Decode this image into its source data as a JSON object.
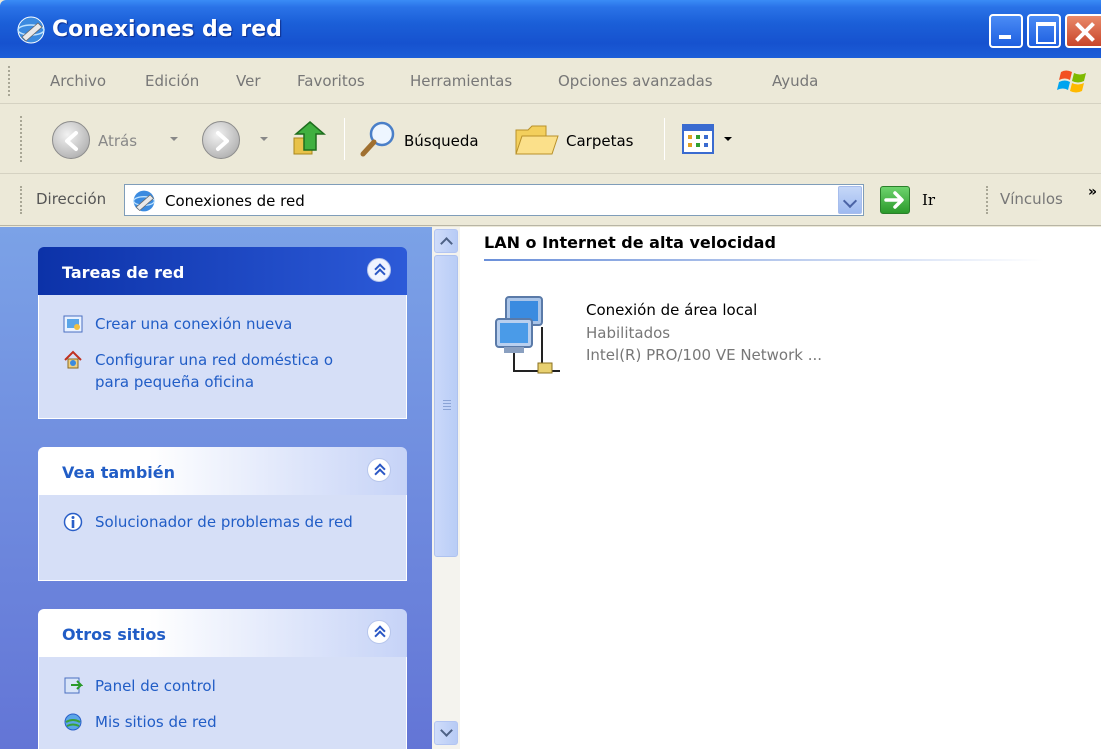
{
  "window": {
    "title": "Conexiones de red"
  },
  "menu": [
    "Archivo",
    "Edición",
    "Ver",
    "Favoritos",
    "Herramientas",
    "Opciones avanzadas",
    "Ayuda"
  ],
  "toolbar": {
    "back_label": "Atrás",
    "search_label": "Búsqueda",
    "folders_label": "Carpetas"
  },
  "address": {
    "label": "Dirección",
    "value": "Conexiones de red",
    "go_label": "Ir",
    "links_label": "Vínculos"
  },
  "tasks": {
    "network": {
      "title": "Tareas de red",
      "items": [
        {
          "label": "Crear una conexión nueva",
          "icon": "new-connection-icon"
        },
        {
          "label": "Configurar una red doméstica o para pequeña oficina",
          "icon": "home-network-icon"
        }
      ]
    },
    "see_also": {
      "title": "Vea también",
      "items": [
        {
          "label": "Solucionador de problemas de red",
          "icon": "info-icon"
        }
      ]
    },
    "other_places": {
      "title": "Otros sitios",
      "items": [
        {
          "label": "Panel de control",
          "icon": "control-panel-icon"
        },
        {
          "label": "Mis sitios de red",
          "icon": "network-places-icon"
        }
      ]
    }
  },
  "content": {
    "group_title": "LAN o Internet de alta velocidad",
    "connection": {
      "name": "Conexión de área local",
      "status": "Habilitados",
      "device": "Intel(R) PRO/100 VE Network ..."
    }
  },
  "colors": {
    "titlebar": "#1652cf",
    "task_link": "#215dc6",
    "left_pane": "#7ba2e7",
    "panel_body": "#d6dff7"
  }
}
